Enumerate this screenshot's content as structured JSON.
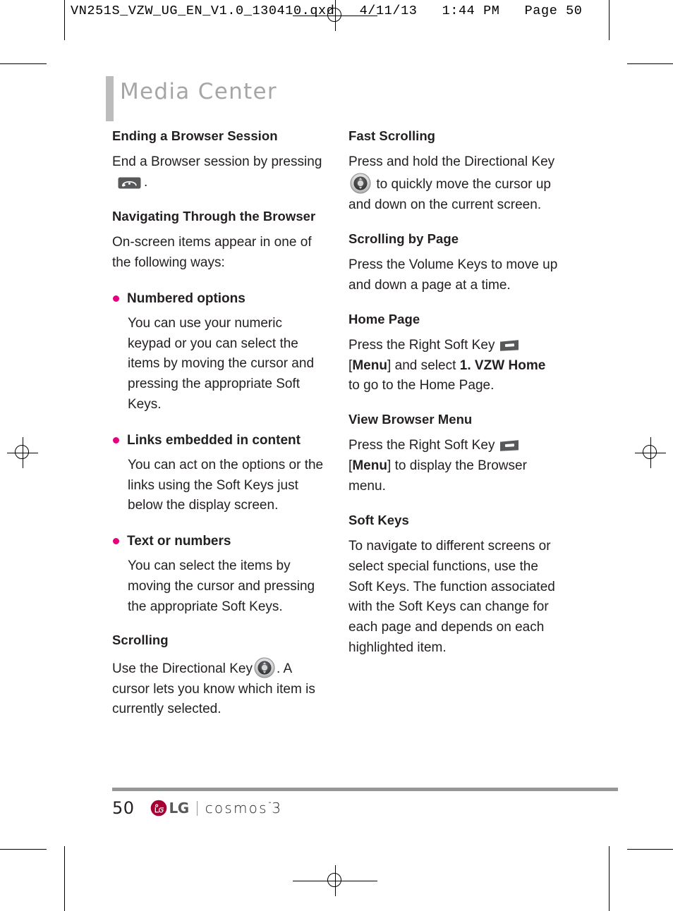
{
  "slug": {
    "text": "VN251S_VZW_UG_EN_V1.0_130410.qxd   4/11/13   1:44 PM   Page 50"
  },
  "chapter": {
    "title": "Media Center",
    "accent_color": "#bcbcbc",
    "title_color": "#a6a6a6"
  },
  "colors": {
    "bullet": "#e6007e",
    "body_text": "#231f20",
    "rule": "#969696",
    "lg_red": "#a50034"
  },
  "left_column": [
    {
      "kind": "heading",
      "name": "heading-ending-a-browser-session",
      "text": "Ending a Browser Session"
    },
    {
      "kind": "paragraph-endcall",
      "name": "paragraph-end-browser-session",
      "text_before": "End a Browser session by pressing",
      "icon": "end-call-key-icon",
      "text_after": "."
    },
    {
      "kind": "heading",
      "name": "heading-navigating-through-the-browser",
      "text": "Navigating Through the Browser"
    },
    {
      "kind": "paragraph",
      "name": "paragraph-on-screen-items",
      "text": "On-screen items appear in one of the following ways:"
    },
    {
      "kind": "bullet",
      "name": "bullet-numbered-options",
      "label": "Numbered options",
      "body": "You can use your numeric keypad or you can select the items by moving the cursor and pressing the appropriate Soft Keys."
    },
    {
      "kind": "bullet",
      "name": "bullet-links-embedded-in-content",
      "label": "Links embedded in content",
      "body": "You can act on the options or the links using the Soft Keys just below the display screen."
    },
    {
      "kind": "bullet",
      "name": "bullet-text-or-numbers",
      "label": "Text or numbers",
      "body": "You can select the items by moving the cursor and pressing the appropriate Soft Keys."
    },
    {
      "kind": "heading",
      "name": "heading-scrolling",
      "text": "Scrolling"
    },
    {
      "kind": "paragraph-dkey",
      "name": "paragraph-scrolling-directional-key",
      "text_before": "Use the Directional Key",
      "icon": "directional-key-icon",
      "text_after": ". A cursor lets you know which item is currently selected."
    }
  ],
  "right_column": [
    {
      "kind": "heading",
      "name": "heading-fast-scrolling",
      "text": "Fast Scrolling"
    },
    {
      "kind": "paragraph-dkey",
      "name": "paragraph-fast-scrolling",
      "text_before": "Press and hold the Directional Key",
      "icon": "directional-key-icon",
      "text_after": "to quickly move the cursor up and down on the current screen."
    },
    {
      "kind": "heading",
      "name": "heading-scrolling-by-page",
      "text": "Scrolling by Page"
    },
    {
      "kind": "paragraph",
      "name": "paragraph-scrolling-by-page",
      "text": "Press the Volume Keys to move up and down a page at a time."
    },
    {
      "kind": "heading",
      "name": "heading-home-page",
      "text": "Home Page"
    },
    {
      "kind": "paragraph-softkey",
      "name": "paragraph-home-page",
      "text_before": "Press the Right Soft Key",
      "icon": "right-soft-key-icon",
      "bracket_open": "[",
      "menu_label": "Menu",
      "bracket_close": "]",
      "text_mid": " and select ",
      "bold_item": "1. VZW Home",
      "text_after": " to go to the Home Page."
    },
    {
      "kind": "heading",
      "name": "heading-view-browser-menu",
      "text": "View Browser Menu"
    },
    {
      "kind": "paragraph-softkey2",
      "name": "paragraph-view-browser-menu",
      "text_before": "Press the Right Soft Key",
      "icon": "right-soft-key-icon",
      "bracket_open": "[",
      "menu_label": "Menu",
      "bracket_close": "]",
      "text_after": " to display the Browser menu."
    },
    {
      "kind": "heading",
      "name": "heading-soft-keys",
      "text": "Soft Keys"
    },
    {
      "kind": "paragraph",
      "name": "paragraph-soft-keys",
      "text": "To navigate to different screens or select special functions, use the Soft Keys. The function associated with the Soft Keys can change for each page and depends on each highlighted item."
    }
  ],
  "footer": {
    "page_number": "50",
    "brand": "LG",
    "product": "cosmos",
    "product_tm": "˜",
    "product_version": "3"
  }
}
